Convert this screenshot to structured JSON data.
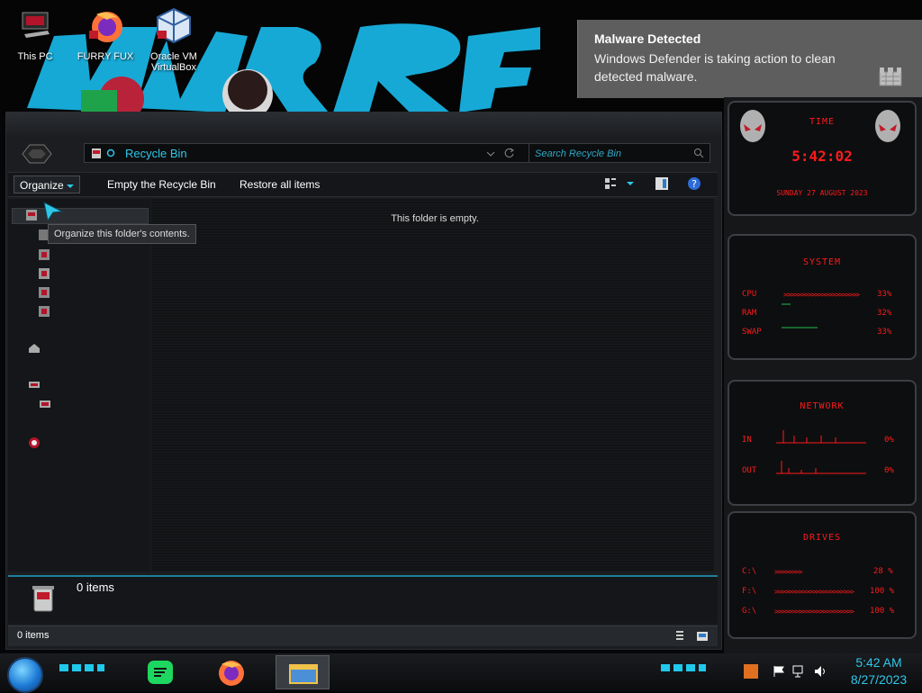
{
  "desktop": {
    "icons": [
      {
        "label": "This PC",
        "icon": "this-pc-icon"
      },
      {
        "label": "FURRY FUX",
        "icon": "firefox-icon"
      },
      {
        "label_line1": "Oracle VM",
        "label_line2": "VirtualBox",
        "icon": "virtualbox-icon"
      }
    ]
  },
  "toast": {
    "title": "Malware Detected",
    "body": "Windows Defender is taking action to clean detected malware.",
    "icon": "defender-castle-icon"
  },
  "explorer": {
    "address": "Recycle Bin",
    "search_placeholder": "Search Recycle Bin",
    "toolbar": {
      "organize": "Organize",
      "empty": "Empty the Recycle Bin",
      "restore": "Restore all items"
    },
    "empty_message": "This folder is empty.",
    "tooltip": "Organize this folder's contents.",
    "details_count": "0 items",
    "status_count": "0 items"
  },
  "gadgets": {
    "time": {
      "title": "TIME",
      "clock": "5:42:02",
      "date": "SUNDAY 27 AUGUST 2023"
    },
    "system": {
      "title": "SYSTEM",
      "rows": [
        {
          "label": "CPU",
          "value": "33%",
          "fraction": 0.33
        },
        {
          "label": "RAM",
          "value": "32%",
          "fraction": 0.32
        },
        {
          "label": "SWAP",
          "value": "33%",
          "fraction": 0.33
        }
      ]
    },
    "network": {
      "title": "NETWORK",
      "rows": [
        {
          "label": "IN",
          "value": "0%"
        },
        {
          "label": "OUT",
          "value": "0%"
        }
      ]
    },
    "drives": {
      "title": "DRIVES",
      "rows": [
        {
          "label": "C:\\",
          "value": "28 %"
        },
        {
          "label": "F:\\",
          "value": "100 %"
        },
        {
          "label": "G:\\",
          "value": "100 %"
        }
      ]
    }
  },
  "taskbar": {
    "time": "5:42 AM",
    "date": "8/27/2023",
    "pinned": [
      "spotify-icon",
      "firefox-icon",
      "file-explorer-icon"
    ],
    "tray": [
      "language-icon",
      "action-center-flag-icon",
      "network-icon",
      "volume-icon"
    ]
  }
}
